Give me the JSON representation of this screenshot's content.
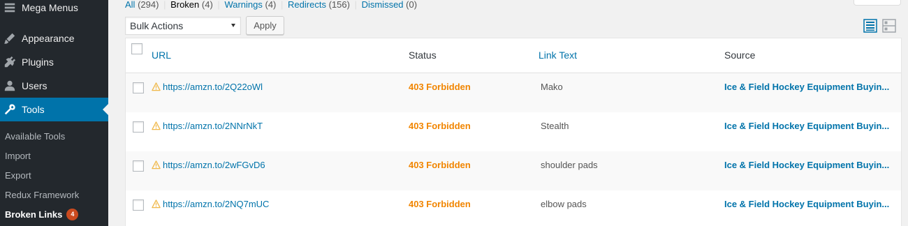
{
  "sidebar": {
    "menu": [
      {
        "label": "Mega Menus",
        "icon": "menu-icon"
      },
      {
        "label": "Appearance",
        "icon": "brush-icon"
      },
      {
        "label": "Plugins",
        "icon": "plug-icon"
      },
      {
        "label": "Users",
        "icon": "user-icon"
      },
      {
        "label": "Tools",
        "icon": "wrench-icon",
        "current": true
      }
    ],
    "submenu": [
      {
        "label": "Available Tools"
      },
      {
        "label": "Import"
      },
      {
        "label": "Export"
      },
      {
        "label": "Redux Framework"
      },
      {
        "label": "Broken Links",
        "active": true,
        "badge": "4"
      }
    ]
  },
  "filters": [
    {
      "label": "All",
      "count": "(294)"
    },
    {
      "label": "Broken",
      "count": "(4)",
      "current": true
    },
    {
      "label": "Warnings",
      "count": "(4)"
    },
    {
      "label": "Redirects",
      "count": "(156)"
    },
    {
      "label": "Dismissed",
      "count": "(0)"
    }
  ],
  "bulk_actions": {
    "selected": "Bulk Actions",
    "apply_label": "Apply"
  },
  "view_modes": [
    "list-view-icon",
    "excerpt-view-icon"
  ],
  "table": {
    "columns": {
      "url": "URL",
      "status": "Status",
      "link_text": "Link Text",
      "source": "Source"
    },
    "rows": [
      {
        "url": "https://amzn.to/2Q22oWl",
        "status": "403 Forbidden",
        "link_text": "Mako",
        "source": "Ice & Field Hockey Equipment Buyin..."
      },
      {
        "url": "https://amzn.to/2NNrNkT",
        "status": "403 Forbidden",
        "link_text": "Stealth",
        "source": "Ice & Field Hockey Equipment Buyin..."
      },
      {
        "url": "https://amzn.to/2wFGvD6",
        "status": "403 Forbidden",
        "link_text": "shoulder pads",
        "source": "Ice & Field Hockey Equipment Buyin..."
      },
      {
        "url": "https://amzn.to/2NQ7mUC",
        "status": "403 Forbidden",
        "link_text": "elbow pads",
        "source": "Ice & Field Hockey Equipment Buyin..."
      }
    ]
  },
  "colors": {
    "accent": "#0073aa",
    "status_warning": "#f18500",
    "sidebar_bg": "#23282d",
    "badge": "#ca4a1f"
  }
}
